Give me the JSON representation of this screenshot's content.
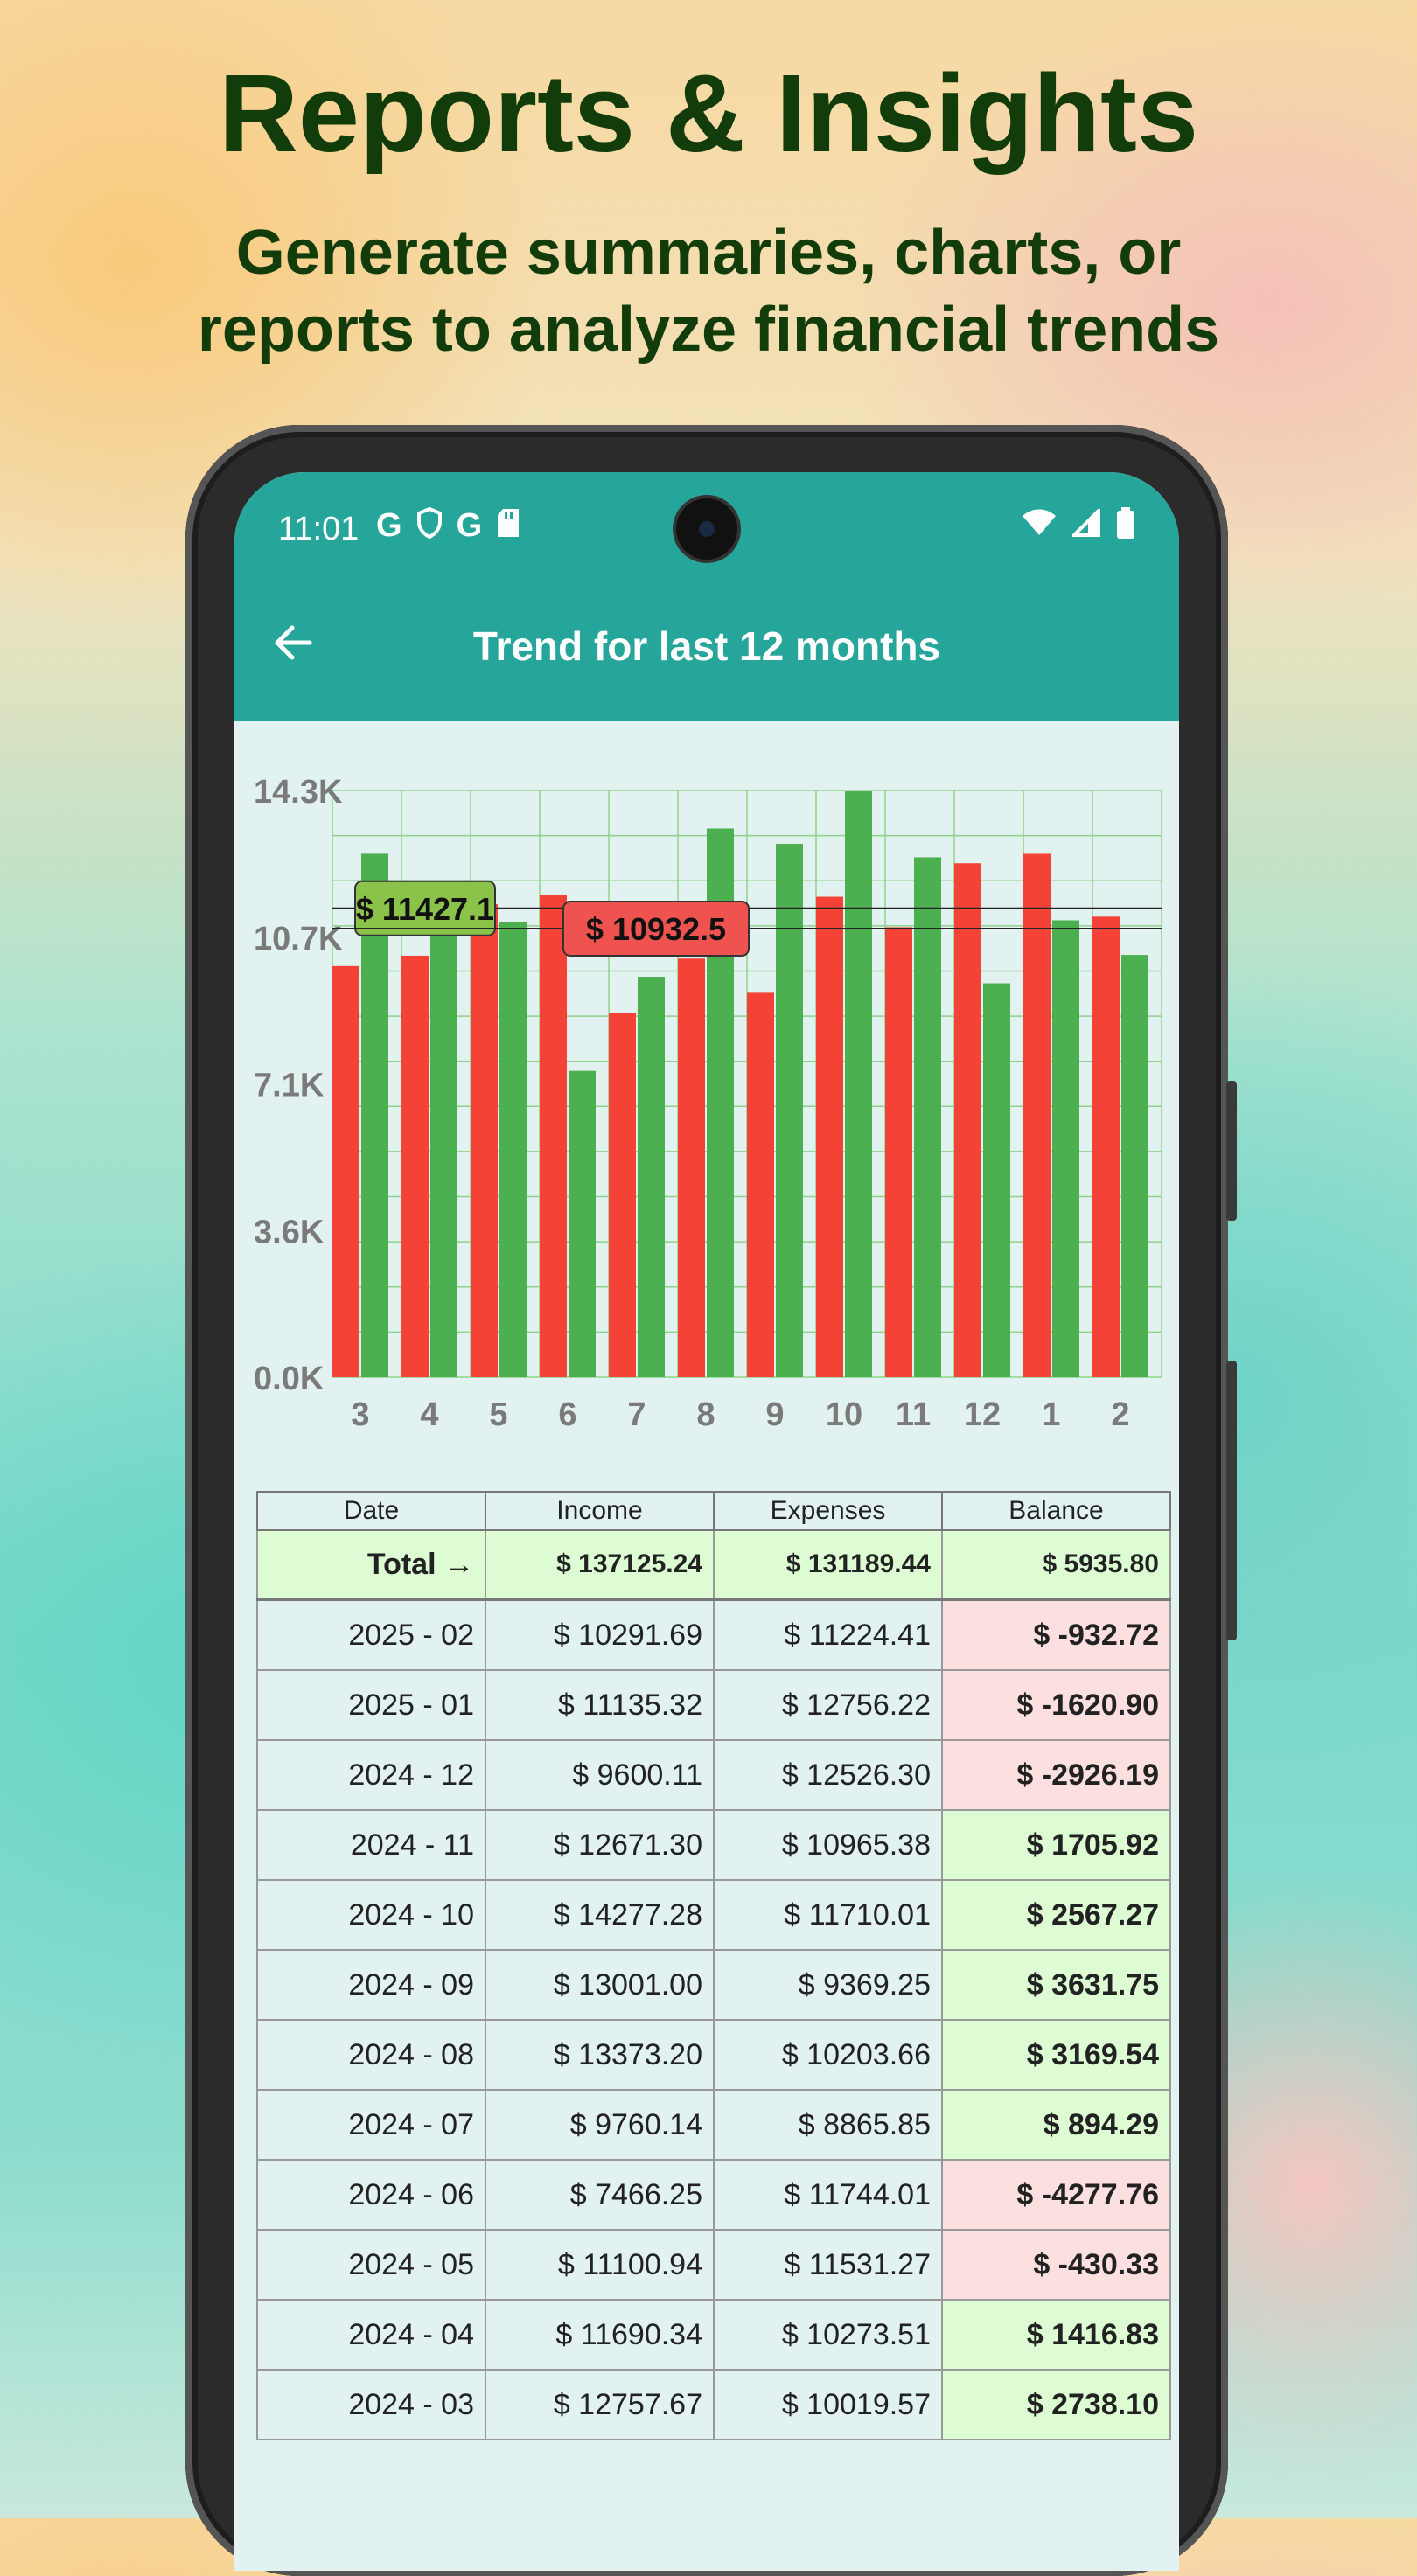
{
  "promo": {
    "title": "Reports & Insights",
    "subtitle_line1": "Generate summaries, charts, or",
    "subtitle_line2": "reports to analyze financial trends"
  },
  "status_bar": {
    "time": "11:01",
    "left_icons": [
      "google-icon",
      "shield-icon",
      "google-icon",
      "sd-card-icon"
    ],
    "right_icons": [
      "wifi-icon",
      "signal-icon",
      "battery-icon"
    ]
  },
  "app_bar": {
    "title": "Trend for last 12 months",
    "back_icon": "back-arrow-icon"
  },
  "colors": {
    "primary": "#26a69a",
    "income": "#4caf50",
    "expense": "#f44336",
    "background": "#e1f2f1"
  },
  "chart_data": {
    "type": "bar",
    "categories": [
      "3",
      "4",
      "5",
      "6",
      "7",
      "8",
      "9",
      "10",
      "11",
      "12",
      "1",
      "2"
    ],
    "series": [
      {
        "color": "#f44336",
        "values": [
          10019.57,
          10273.51,
          11531.27,
          11744.01,
          8865.85,
          10203.66,
          9369.25,
          11710.01,
          10965.38,
          12526.3,
          12756.22,
          11224.41
        ]
      },
      {
        "color": "#4caf50",
        "values": [
          12757.67,
          11690.34,
          11100.94,
          7466.25,
          9760.14,
          13373.2,
          13001.0,
          14277.28,
          12671.3,
          9600.11,
          11135.32,
          10291.69
        ]
      }
    ],
    "y_ticks": [
      "14.3K",
      "10.7K",
      "7.1K",
      "3.6K",
      "0.0K"
    ],
    "ylim": [
      0,
      14300
    ],
    "average_lines": [
      {
        "label": "$ 11427.1",
        "value": 11427.1,
        "color": "#8bc34a"
      },
      {
        "label": "$ 10932.5",
        "value": 10932.5,
        "color": "#ef5350"
      }
    ],
    "grid": true
  },
  "table": {
    "headers": [
      "Date",
      "Income",
      "Expenses",
      "Balance"
    ],
    "total": {
      "label": "Total",
      "arrow": "→",
      "income": "$ 137125.24",
      "expenses": "$ 131189.44",
      "balance": "$ 5935.80"
    },
    "rows": [
      {
        "date": "2025 - 02",
        "income": "$ 10291.69",
        "expenses": "$ 11224.41",
        "balance": "$ -932.72",
        "status": "neg"
      },
      {
        "date": "2025 - 01",
        "income": "$ 11135.32",
        "expenses": "$ 12756.22",
        "balance": "$ -1620.90",
        "status": "neg"
      },
      {
        "date": "2024 - 12",
        "income": "$ 9600.11",
        "expenses": "$ 12526.30",
        "balance": "$ -2926.19",
        "status": "neg"
      },
      {
        "date": "2024 - 11",
        "income": "$ 12671.30",
        "expenses": "$ 10965.38",
        "balance": "$ 1705.92",
        "status": "pos"
      },
      {
        "date": "2024 - 10",
        "income": "$ 14277.28",
        "expenses": "$ 11710.01",
        "balance": "$ 2567.27",
        "status": "pos"
      },
      {
        "date": "2024 - 09",
        "income": "$ 13001.00",
        "expenses": "$ 9369.25",
        "balance": "$ 3631.75",
        "status": "pos"
      },
      {
        "date": "2024 - 08",
        "income": "$ 13373.20",
        "expenses": "$ 10203.66",
        "balance": "$ 3169.54",
        "status": "pos"
      },
      {
        "date": "2024 - 07",
        "income": "$ 9760.14",
        "expenses": "$ 8865.85",
        "balance": "$ 894.29",
        "status": "pos"
      },
      {
        "date": "2024 - 06",
        "income": "$ 7466.25",
        "expenses": "$ 11744.01",
        "balance": "$ -4277.76",
        "status": "neg"
      },
      {
        "date": "2024 - 05",
        "income": "$ 11100.94",
        "expenses": "$ 11531.27",
        "balance": "$ -430.33",
        "status": "neg"
      },
      {
        "date": "2024 - 04",
        "income": "$ 11690.34",
        "expenses": "$ 10273.51",
        "balance": "$ 1416.83",
        "status": "pos"
      },
      {
        "date": "2024 - 03",
        "income": "$ 12757.67",
        "expenses": "$ 10019.57",
        "balance": "$ 2738.10",
        "status": "pos"
      }
    ]
  }
}
